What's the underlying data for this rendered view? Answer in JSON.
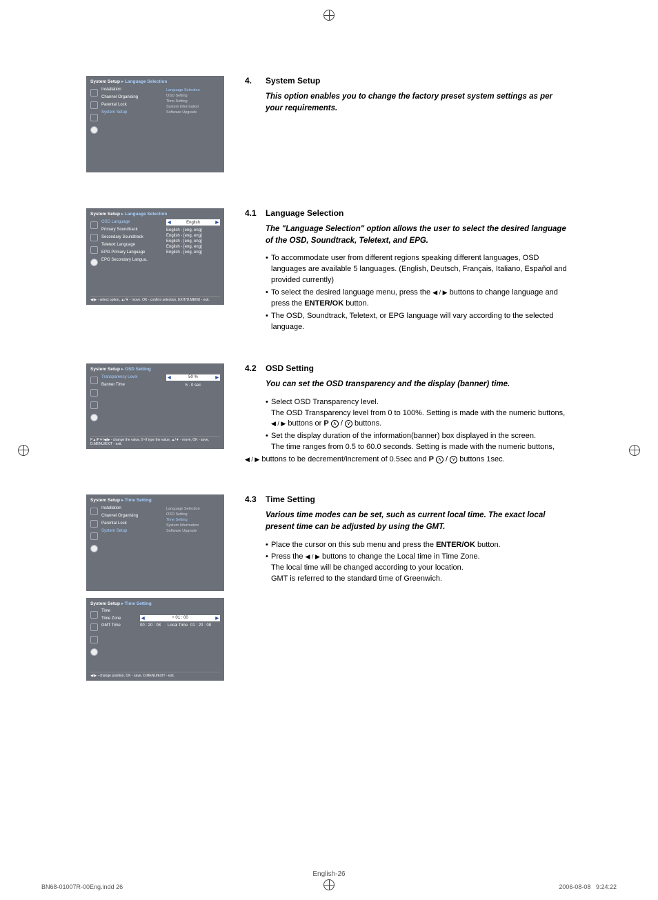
{
  "crop_marks": true,
  "sections": {
    "s4": {
      "num": "4.",
      "title": "System Setup",
      "desc": "This option enables you to change the factory preset system settings as per your requirements."
    },
    "s41": {
      "num": "4.1",
      "title": "Language Selection",
      "desc": "The \"Language Selection\" option allows the user to select the desired language of the OSD, Soundtrack, Teletext, and EPG.",
      "b1a": "To accommodate user from different regions speaking different languages, OSD languages are available 5 languages. (English, Deutsch, Français, Italiano, Español and  provided currently)",
      "b2a": "To select the desired language menu, press the ",
      "b2b": " buttons to change language and press the ",
      "b2c": "ENTER/OK",
      "b2d": " button.",
      "b3": "The OSD, Soundtrack, Teletext, or EPG language will vary according to the selected language."
    },
    "s42": {
      "num": "4.2",
      "title": "OSD Setting",
      "desc": "You can set the OSD transparency and the display (banner) time.",
      "b1a": "Select OSD Transparency level.",
      "b1b": "The OSD Transparency level from 0 to 100%. Setting is made with the numeric buttons, ",
      "b1c": " buttons or ",
      "b1d": " buttons.",
      "b2a": "Set the display duration of the information(banner) box displayed in the screen.",
      "b2b": "The time ranges from 0.5 to 60.0 seconds. Setting is made with the numeric buttons,",
      "out_a": " buttons to be decrement/increment of 0.5sec and ",
      "out_b": " buttons 1sec."
    },
    "s43": {
      "num": "4.3",
      "title": "Time Setting",
      "desc": "Various time modes can be set, such as current local time. The exact local present time can be adjusted by using the GMT.",
      "b1a": "Place the cursor on this sub menu and press the ",
      "b1b": "ENTER/OK",
      "b1c": " button.",
      "b2a": "Press the ",
      "b2b": " buttons to change the Local time in Time Zone.",
      "b2c": "The local time will be changed according to your location.",
      "b2d": "GMT is referred to the standard time of Greenwich."
    }
  },
  "screens": {
    "sc1": {
      "bread1": "System Setup",
      "bread2": "Language Selection",
      "menu": [
        "Installation",
        "Channel Organising",
        "Parental Lock",
        "System Setup"
      ],
      "hl_index": 3,
      "sub": [
        "Language Selection",
        "OSD Setting",
        "Time Setting",
        "System Information",
        "Software Upgrade"
      ],
      "sub_hl": 0
    },
    "sc2": {
      "bread1": "System Setup",
      "bread2": "Language Selection",
      "rows": [
        {
          "l": "OSD Language",
          "v": "English",
          "sel": true
        },
        {
          "l": "Primary Soundtrack",
          "v": "English - [eng, eng]"
        },
        {
          "l": "Secondary Soundtrack",
          "v": "English - [eng, eng]"
        },
        {
          "l": "Teletext Language",
          "v": "English - [eng, eng]"
        },
        {
          "l": "EPG Primary Language",
          "v": "English - [eng, eng]"
        },
        {
          "l": "EPG Secondary Langua..",
          "v": "English - [eng, eng]"
        }
      ],
      "hint": "◀/▶ - select option, ▲/▼ - move, OK - confirm selection, EXIT/D.MENU - exit."
    },
    "sc3": {
      "bread1": "System Setup",
      "bread2": "OSD Setting",
      "rows": [
        {
          "l": "Transparency Level",
          "v": "50 %",
          "sel": true
        },
        {
          "l": "Banner Time",
          "v": "5 . 0 sec"
        }
      ],
      "hint": "P▲/P▼/◀/▶ - change the value, 0~9 type the value, ▲/▼ - move, OK - save, D.MENU/EXIT - exit."
    },
    "sc4": {
      "bread1": "System Setup",
      "bread2": "Time Setting",
      "menu": [
        "Installation",
        "Channel Organising",
        "Parental Lock",
        "System Setup"
      ],
      "hl_index": 3,
      "sub": [
        "Language Selection",
        "OSD Setting",
        "Time Setting",
        "System Information",
        "Software Upgrade"
      ],
      "sub_hl": 2
    },
    "sc5": {
      "bread1": "System Setup",
      "bread2": "Time Setting",
      "time_lbl": "Time",
      "tz_lbl": "Time Zone",
      "tz_val": "+ 01 : 00",
      "gmt_lbl": "GMT Time",
      "gmt_val": "00 : 20 : 08",
      "local_lbl": "Local Time",
      "local_val": "01 : 20 : 08",
      "hint": "◀/▶ - change position, OK - save, D.MENU/EXIT - exit."
    }
  },
  "symbols": {
    "lr": "◀ / ▶",
    "p": "P",
    "up": "∧",
    "dn": "∨",
    "slash": " / "
  },
  "footer": {
    "page": "English-26",
    "file": "BN68-01007R-00Eng.indd   26",
    "date": "2006-08-08",
    "time": "9:24:22"
  }
}
